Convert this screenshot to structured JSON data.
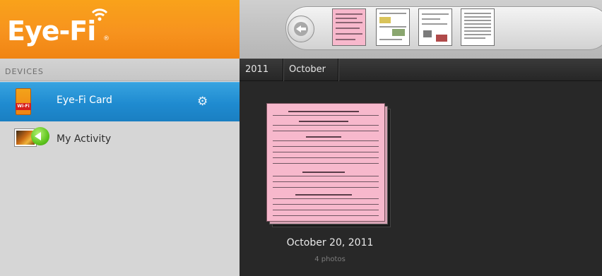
{
  "brand": {
    "logo_text": "Eye-Fi",
    "logo_mark": "®"
  },
  "toolbar": {
    "back_icon": "back-arrow-icon",
    "thumbnails": [
      {
        "name": "thumb-pink-form",
        "color": "#f7b8cc"
      },
      {
        "name": "thumb-form-2",
        "color": "#f2f2f2"
      },
      {
        "name": "thumb-form-3",
        "color": "#f4f4f4"
      },
      {
        "name": "thumb-form-4",
        "color": "#eeeeee"
      }
    ]
  },
  "sidebar": {
    "section_label": "DEVICES",
    "items": [
      {
        "label": "Eye-Fi Card",
        "icon": "eyefi-card-icon",
        "selected": true,
        "settings_icon": "gear-icon",
        "card_badge": "Wi-Fi"
      },
      {
        "label": "My Activity",
        "icon": "activity-icon",
        "selected": false
      }
    ]
  },
  "breadcrumb": {
    "year": "2011",
    "month": "October"
  },
  "album": {
    "title": "October 20, 2011",
    "count": "4 photos"
  },
  "colors": {
    "brand_orange": "#f7931e",
    "selected_blue": "#1f8bd0",
    "content_bg": "#282828",
    "sidebar_bg": "#d6d6d6"
  }
}
